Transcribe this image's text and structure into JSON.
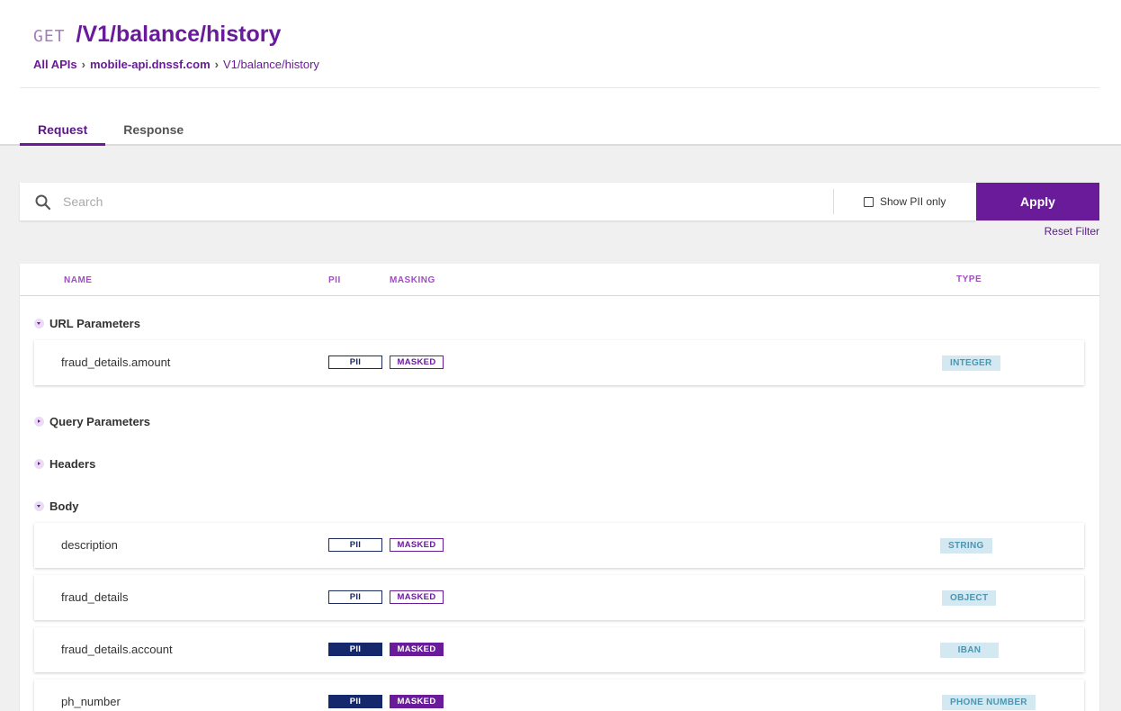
{
  "header": {
    "method": "GET",
    "path": "/V1/balance/history",
    "breadcrumb": [
      "All APIs",
      "mobile-api.dnssf.com",
      "V1/balance/history"
    ]
  },
  "tabs": [
    {
      "label": "Request",
      "active": true
    },
    {
      "label": "Response",
      "active": false
    }
  ],
  "filter": {
    "search_placeholder": "Search",
    "search_value": "",
    "show_pii_label": "Show PII only",
    "show_pii_checked": false,
    "apply_label": "Apply",
    "reset_label": "Reset Filter"
  },
  "table": {
    "columns": {
      "name": "NAME",
      "pii": "PII",
      "masking": "MASKING",
      "type": "TYPE"
    },
    "sections": [
      {
        "label": "URL Parameters",
        "expanded": true,
        "rows": [
          {
            "name": "fraud_details.amount",
            "pii": "PII",
            "masking": "MASKED",
            "filled": false,
            "type": "INTEGER"
          }
        ]
      },
      {
        "label": "Query Parameters",
        "expanded": false,
        "rows": []
      },
      {
        "label": "Headers",
        "expanded": false,
        "rows": []
      },
      {
        "label": "Body",
        "expanded": true,
        "rows": [
          {
            "name": "description",
            "pii": "PII",
            "masking": "MASKED",
            "filled": false,
            "type": "STRING"
          },
          {
            "name": "fraud_details",
            "pii": "PII",
            "masking": "MASKED",
            "filled": false,
            "type": "OBJECT"
          },
          {
            "name": "fraud_details.account",
            "pii": "PII",
            "masking": "MASKED",
            "filled": true,
            "type": "IBAN"
          },
          {
            "name": "ph_number",
            "pii": "PII",
            "masking": "MASKED",
            "filled": true,
            "type": "PHONE NUMBER"
          }
        ]
      }
    ]
  },
  "colors": {
    "accent": "#6a1b9a",
    "pii_filled": "#14286b",
    "type_bg": "#d3e8f0",
    "type_text": "#4c96b3"
  }
}
